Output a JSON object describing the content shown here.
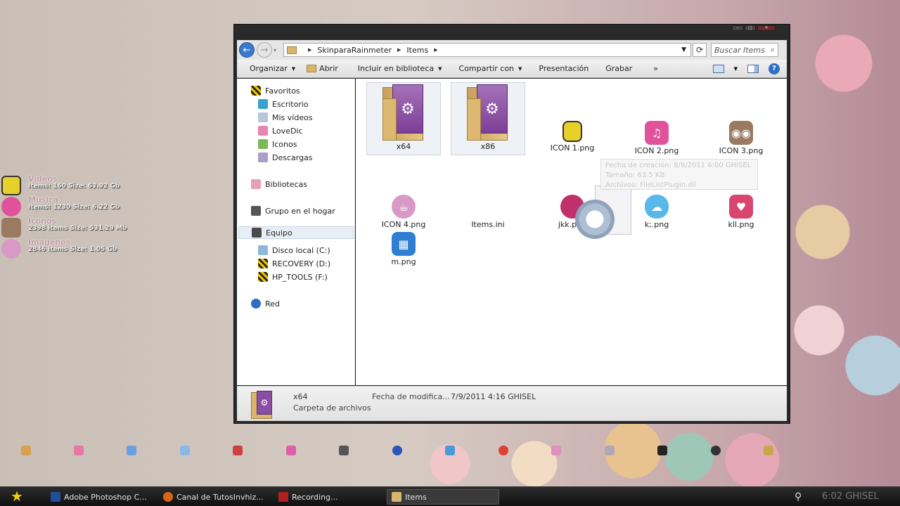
{
  "desktop_skin": [
    {
      "name": "Videos",
      "info": "Items: 160  Size: 63.92 Gb",
      "color": "#e8d02a"
    },
    {
      "name": "Musica",
      "info": "Items: 1230 Size: 6.22 Gb",
      "color": "#e0529a"
    },
    {
      "name": "Iconos",
      "info": "2398 items  Size: 531.29 Mb",
      "color": "#9a7a60"
    },
    {
      "name": "Imagenes",
      "info": "2846 items  Size: 1.05 Gb",
      "color": "#d899c6"
    }
  ],
  "explorer": {
    "breadcrumb": [
      "SkinparaRainmeter",
      "Items"
    ],
    "search_placeholder": "Buscar Items",
    "toolbar": {
      "organize": "Organizar",
      "open": "Abrir",
      "library": "Incluir en biblioteca",
      "share": "Compartir con",
      "presentation": "Presentación",
      "burn": "Grabar",
      "more": "»"
    },
    "nav": {
      "favorites": "Favoritos",
      "desktop": "Escritorio",
      "videos": "Mis vídeos",
      "lovedic": "LoveDic",
      "icons": "Iconos",
      "downloads": "Descargas",
      "libraries": "Bibliotecas",
      "homegroup": "Grupo en el hogar",
      "computer": "Equipo",
      "drive_c": "Disco local (C:)",
      "drive_d": "RECOVERY (D:)",
      "drive_f": "HP_TOOLS (F:)",
      "network": "Red"
    },
    "files": [
      {
        "name": "x64"
      },
      {
        "name": "x86"
      },
      {
        "name": "ICON 1.png"
      },
      {
        "name": "ICON 2.png"
      },
      {
        "name": "ICON 3.png"
      },
      {
        "name": "ICON 4.png"
      },
      {
        "name": "Items.ini"
      },
      {
        "name": "jkk.png"
      },
      {
        "name": "k;.png"
      },
      {
        "name": "kll.png"
      },
      {
        "name": "m.png"
      }
    ],
    "tooltip": {
      "created": "Fecha de creación: 8/9/2011 6:00 GHISEL",
      "size": "Tamaño: 63.5 KB",
      "files": "Archivos: FileListPlugin.dll"
    },
    "details": {
      "name": "x64",
      "type": "Carpeta de archivos",
      "modified_label": "Fecha de modifica...",
      "modified_value": "7/9/2011 4:16 GHISEL"
    }
  },
  "taskbar": {
    "tasks": [
      {
        "label": "Adobe Photoshop C...",
        "color": "#1f4f9a"
      },
      {
        "label": "Canal de TutosInvhiz...",
        "color": "#d9651b"
      },
      {
        "label": "Recording...",
        "color": "#b02020"
      },
      {
        "label": "Items",
        "color": "#d8b66a"
      }
    ],
    "clock": "6:02 GHISEL"
  }
}
